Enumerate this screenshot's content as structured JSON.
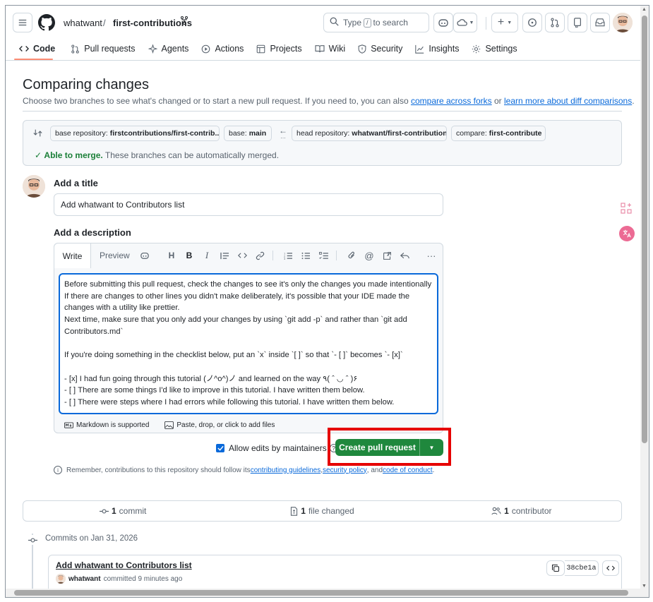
{
  "header": {
    "owner": "whatwant",
    "separator": "/",
    "repo": "first-contributions",
    "search_pre": "Type",
    "search_key": "/",
    "search_post": "to search"
  },
  "tabs": [
    {
      "label": "Code"
    },
    {
      "label": "Pull requests"
    },
    {
      "label": "Agents"
    },
    {
      "label": "Actions"
    },
    {
      "label": "Projects"
    },
    {
      "label": "Wiki"
    },
    {
      "label": "Security"
    },
    {
      "label": "Insights"
    },
    {
      "label": "Settings"
    }
  ],
  "page": {
    "title": "Comparing changes",
    "subtitle_pre": "Choose two branches to see what's changed or to start a new pull request. If you need to, you can also ",
    "subtitle_link1": "compare across forks",
    "subtitle_mid": " or ",
    "subtitle_link2": "learn more about diff comparisons",
    "subtitle_post": "."
  },
  "range": {
    "base_repo_label": "base repository:",
    "base_repo_value": "firstcontributions/first-contrib...",
    "base_label": "base:",
    "base_value": "main",
    "head_repo_label": "head repository:",
    "head_repo_value": "whatwant/first-contributions",
    "compare_label": "compare:",
    "compare_value": "first-contribute",
    "merge_ok": "Able to merge.",
    "merge_note": "These branches can be automatically merged."
  },
  "form": {
    "title_label": "Add a title",
    "title_value": "Add whatwant to Contributors list",
    "desc_label": "Add a description",
    "tab_write": "Write",
    "tab_preview": "Preview",
    "body": "Before submitting this pull request, check the changes to see it's only the changes you made intentionally\nIf there are changes to other lines you didn't make deliberately, it's possible that your IDE made the changes with a utility like prettier.\nNext time, make sure that you only add your changes by using `git add -p` and rather than `git add Contributors.md`\n\nIf you're doing something in the checklist below, put an `x` inside `[ ]` so that `- [ ]` becomes `- [x]`\n\n- [x] I had fun going through this tutorial (ノ^o^)ノ and learned on the way ٩( ˆ ◡ ˆ )۶\n- [ ] There are some things I'd like to improve in this tutorial. I have written them below.\n- [ ] There were steps where I had errors while following this tutorial. I have written them below.",
    "markdown_note": "Markdown is supported",
    "attach_note": "Paste, drop, or click to add files",
    "allow_edits": "Allow edits by maintainers",
    "create_button": "Create pull request",
    "remember_pre": "Remember, contributions to this repository should follow its ",
    "remember_link1": "contributing guidelines",
    "remember_sep1": ", ",
    "remember_link2": "security policy",
    "remember_sep2": ", and ",
    "remember_link3": "code of conduct",
    "remember_post": "."
  },
  "stats": {
    "commits_count": "1",
    "commits_label": "commit",
    "files_count": "1",
    "files_label": "file changed",
    "contrib_count": "1",
    "contrib_label": "contributor"
  },
  "commits": {
    "date_header": "Commits on Jan 31, 2026",
    "message": "Add whatwant to Contributors list",
    "author": "whatwant",
    "meta": "committed 9 minutes ago",
    "sha": "38cbe1a"
  },
  "colors": {
    "accent": "#0969da",
    "primary_button": "#1f883d",
    "highlight": "#e60000",
    "tab_underline": "#fd8c73"
  }
}
